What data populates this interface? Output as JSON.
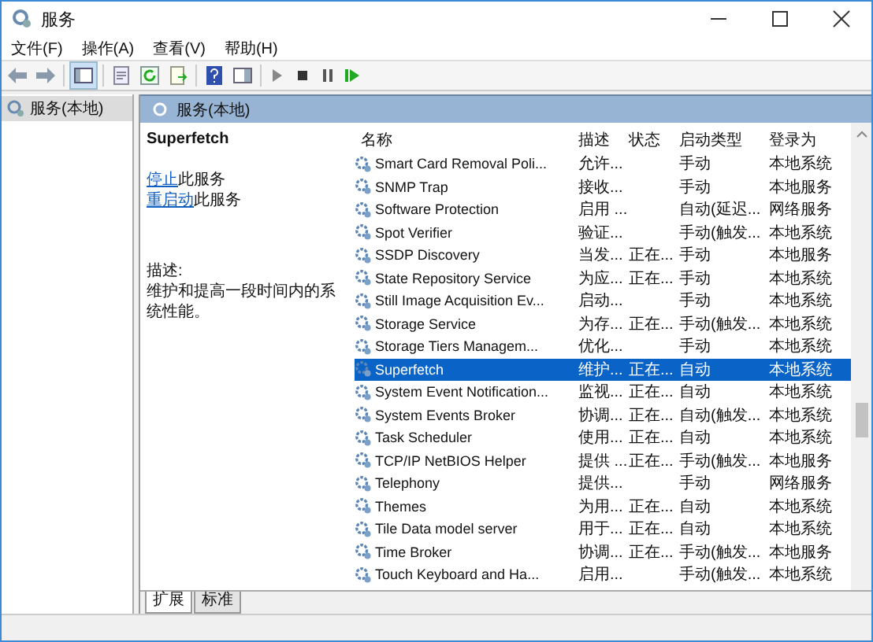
{
  "window": {
    "title": "服务"
  },
  "menu": [
    "文件(F)",
    "操作(A)",
    "查看(V)",
    "帮助(H)"
  ],
  "toolbar": [
    {
      "kind": "back"
    },
    {
      "kind": "forward"
    },
    {
      "kind": "sep"
    },
    {
      "kind": "tree"
    },
    {
      "kind": "sep"
    },
    {
      "kind": "props"
    },
    {
      "kind": "refresh"
    },
    {
      "kind": "export"
    },
    {
      "kind": "sep"
    },
    {
      "kind": "help"
    },
    {
      "kind": "view"
    },
    {
      "kind": "sep"
    },
    {
      "kind": "play"
    },
    {
      "kind": "stop"
    },
    {
      "kind": "pause"
    },
    {
      "kind": "resume"
    }
  ],
  "tree": [
    {
      "label": "服务(本地)",
      "selected": true
    }
  ],
  "panel": {
    "title": "服务(本地)"
  },
  "detail": {
    "title": "Superfetch",
    "actions": [
      {
        "link": "停止",
        "text": "此服务"
      },
      {
        "link": "重启动",
        "text": "此服务"
      }
    ],
    "description_label": "描述:",
    "description": "维护和提高一段时间内的系统性能。"
  },
  "table": {
    "columns": [
      "名称",
      "描述",
      "状态",
      "启动类型",
      "登录为"
    ],
    "rows": [
      {
        "cells": [
          "Smart Card Removal Poli...",
          "允许...",
          "",
          "手动",
          "本地系统"
        ],
        "selected": false
      },
      {
        "cells": [
          "SNMP Trap",
          "接收...",
          "",
          "手动",
          "本地服务"
        ],
        "selected": false
      },
      {
        "cells": [
          "Software Protection",
          "启用 ...",
          "",
          "自动(延迟...",
          "网络服务"
        ],
        "selected": false
      },
      {
        "cells": [
          "Spot Verifier",
          "验证...",
          "",
          "手动(触发...",
          "本地系统"
        ],
        "selected": false
      },
      {
        "cells": [
          "SSDP Discovery",
          "当发...",
          "正在...",
          "手动",
          "本地服务"
        ],
        "selected": false
      },
      {
        "cells": [
          "State Repository Service",
          "为应...",
          "正在...",
          "手动",
          "本地系统"
        ],
        "selected": false
      },
      {
        "cells": [
          "Still Image Acquisition Ev...",
          "启动...",
          "",
          "手动",
          "本地系统"
        ],
        "selected": false
      },
      {
        "cells": [
          "Storage Service",
          "为存...",
          "正在...",
          "手动(触发...",
          "本地系统"
        ],
        "selected": false
      },
      {
        "cells": [
          "Storage Tiers Managem...",
          "优化...",
          "",
          "手动",
          "本地系统"
        ],
        "selected": false
      },
      {
        "cells": [
          "Superfetch",
          "维护...",
          "正在...",
          "自动",
          "本地系统"
        ],
        "selected": true
      },
      {
        "cells": [
          "System Event Notification...",
          "监视...",
          "正在...",
          "自动",
          "本地系统"
        ],
        "selected": false
      },
      {
        "cells": [
          "System Events Broker",
          "协调...",
          "正在...",
          "自动(触发...",
          "本地系统"
        ],
        "selected": false
      },
      {
        "cells": [
          "Task Scheduler",
          "使用...",
          "正在...",
          "自动",
          "本地系统"
        ],
        "selected": false
      },
      {
        "cells": [
          "TCP/IP NetBIOS Helper",
          "提供 ...",
          "正在...",
          "手动(触发...",
          "本地服务"
        ],
        "selected": false
      },
      {
        "cells": [
          "Telephony",
          "提供...",
          "",
          "手动",
          "网络服务"
        ],
        "selected": false
      },
      {
        "cells": [
          "Themes",
          "为用...",
          "正在...",
          "自动",
          "本地系统"
        ],
        "selected": false
      },
      {
        "cells": [
          "Tile Data model server",
          "用于...",
          "正在...",
          "自动",
          "本地系统"
        ],
        "selected": false
      },
      {
        "cells": [
          "Time Broker",
          "协调...",
          "正在...",
          "手动(触发...",
          "本地服务"
        ],
        "selected": false
      },
      {
        "cells": [
          "Touch Keyboard and Ha...",
          "启用...",
          "",
          "手动(触发...",
          "本地系统"
        ],
        "selected": false
      }
    ]
  },
  "tabs": [
    {
      "label": "扩展",
      "selected": true
    },
    {
      "label": "标准",
      "selected": false
    }
  ]
}
